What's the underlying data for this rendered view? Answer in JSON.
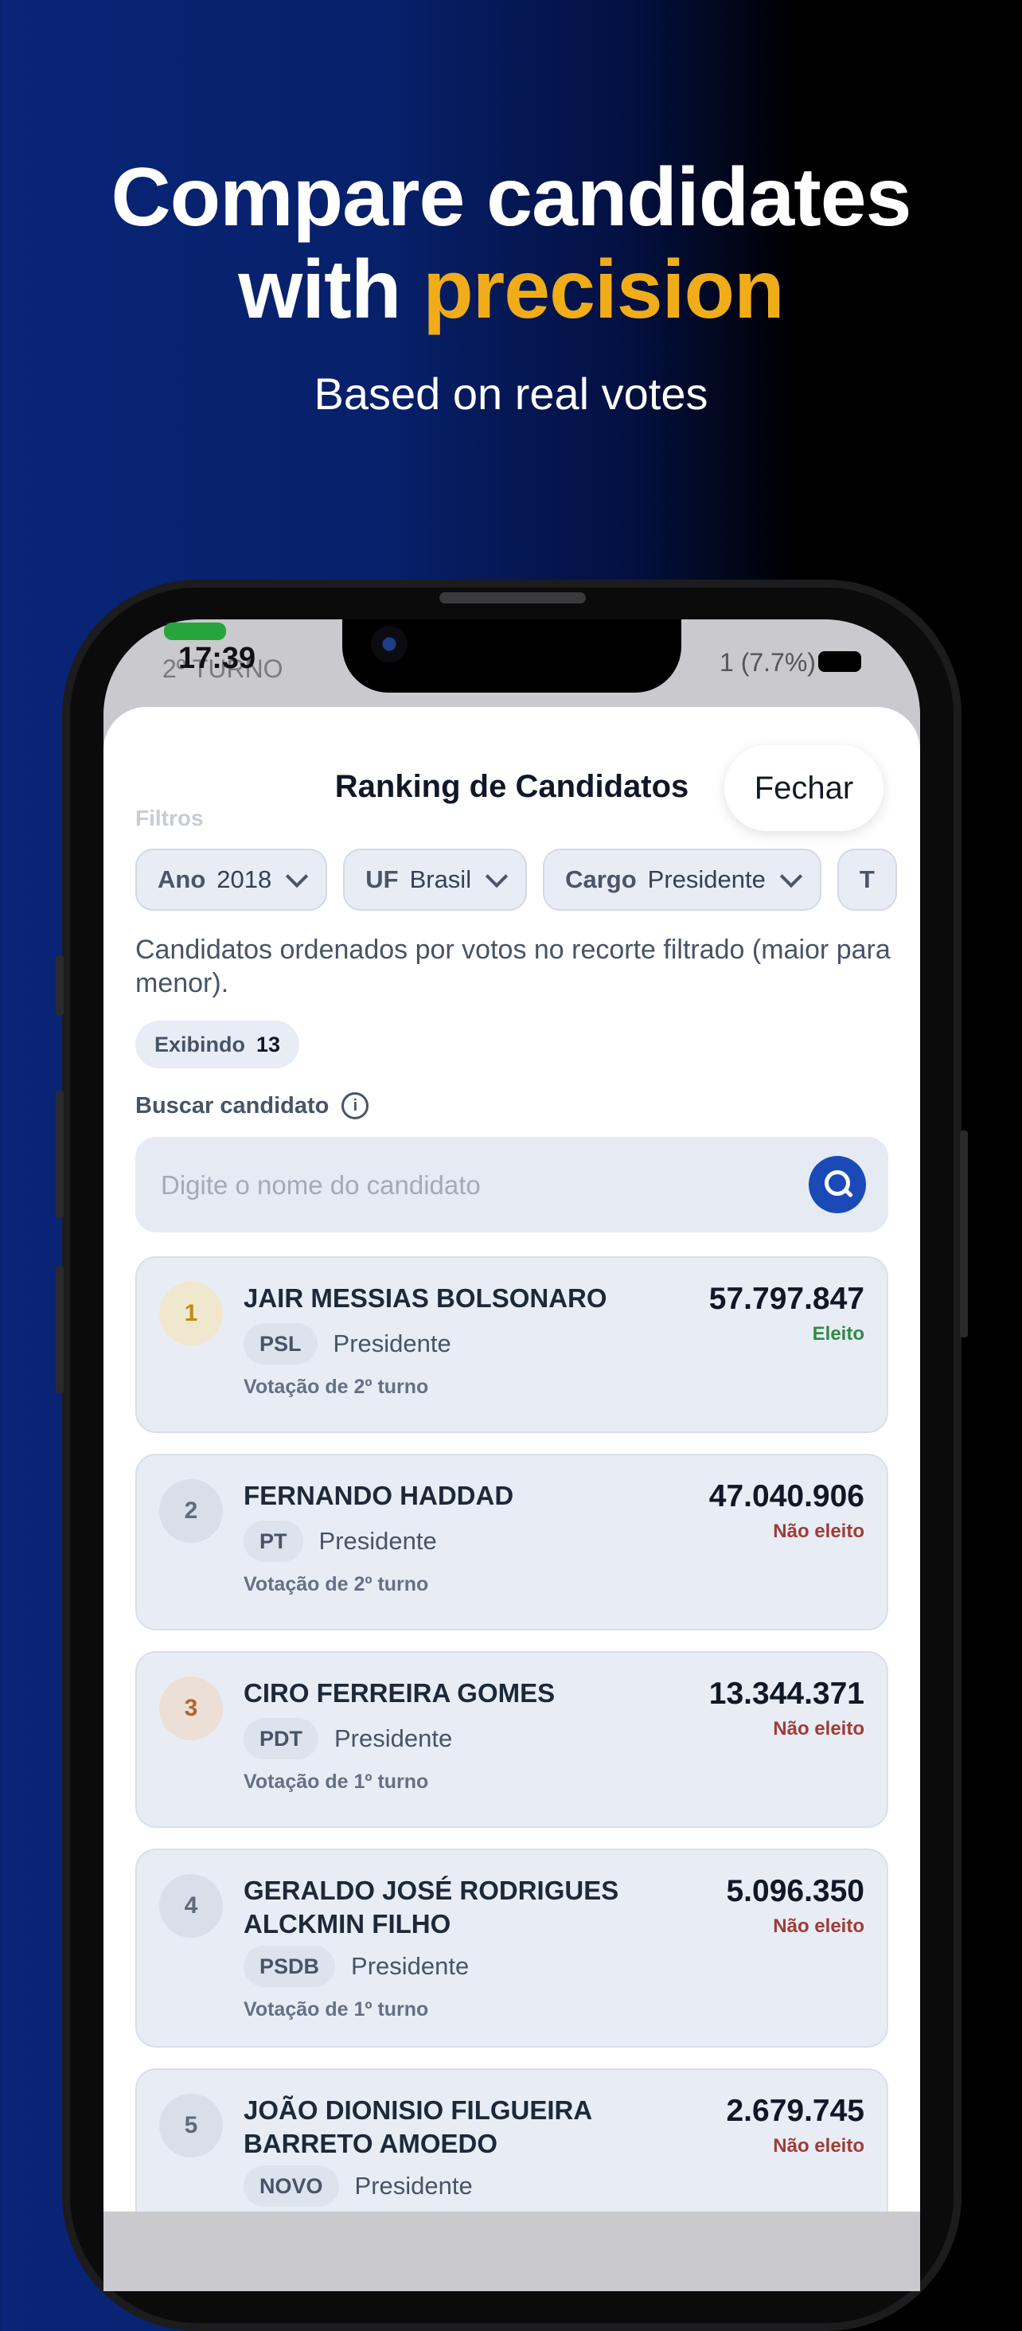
{
  "hero": {
    "title_line1": "Compare candidates",
    "title_line2_prefix": "with ",
    "title_line2_accent": "precision",
    "subtitle": "Based on real votes"
  },
  "status_bar": {
    "time": "17:39",
    "background_text": "2º TURNO",
    "right_text": "1 (7.7%)"
  },
  "sheet": {
    "title": "Ranking de Candidatos",
    "close_label": "Fechar",
    "filters_label": "Filtros",
    "filters": [
      {
        "label": "Ano",
        "value": "2018"
      },
      {
        "label": "UF",
        "value": "Brasil"
      },
      {
        "label": "Cargo",
        "value": "Presidente"
      },
      {
        "label": "T",
        "value": ""
      }
    ],
    "description": "Candidatos ordenados por votos no recorte filtrado (maior para menor).",
    "showing_label": "Exibindo",
    "showing_count": "13",
    "search_label": "Buscar candidato",
    "search_placeholder": "Digite o nome do candidato",
    "search_value": ""
  },
  "candidates": [
    {
      "rank": "1",
      "name": "JAIR MESSIAS BOLSONARO",
      "party": "PSL",
      "office": "Presidente",
      "round": "Votação de 2º turno",
      "votes": "57.797.847",
      "result": "Eleito",
      "rank_bg": "#efe8cf",
      "rank_color": "#c48a12"
    },
    {
      "rank": "2",
      "name": "FERNANDO HADDAD",
      "party": "PT",
      "office": "Presidente",
      "round": "Votação de 2º turno",
      "votes": "47.040.906",
      "result": "Não eleito",
      "rank_bg": "#d9dfe8",
      "rank_color": "#5d6b7d"
    },
    {
      "rank": "3",
      "name": "CIRO FERREIRA GOMES",
      "party": "PDT",
      "office": "Presidente",
      "round": "Votação de 1º turno",
      "votes": "13.344.371",
      "result": "Não eleito",
      "rank_bg": "#ecdfd6",
      "rank_color": "#b0662c"
    },
    {
      "rank": "4",
      "name": "GERALDO JOSÉ RODRIGUES ALCKMIN FILHO",
      "party": "PSDB",
      "office": "Presidente",
      "round": "Votação de 1º turno",
      "votes": "5.096.350",
      "result": "Não eleito",
      "rank_bg": "#d9dfe8",
      "rank_color": "#5d6b7d"
    },
    {
      "rank": "5",
      "name": "JOÃO DIONISIO FILGUEIRA BARRETO AMOEDO",
      "party": "NOVO",
      "office": "Presidente",
      "round": "",
      "votes": "2.679.745",
      "result": "Não eleito",
      "rank_bg": "#d9dfe8",
      "rank_color": "#5d6b7d"
    }
  ],
  "colors": {
    "accent": "#f0ad19",
    "primary_button": "#1b4ab8",
    "elected": "#2e8b45",
    "not_elected": "#a13b36"
  }
}
